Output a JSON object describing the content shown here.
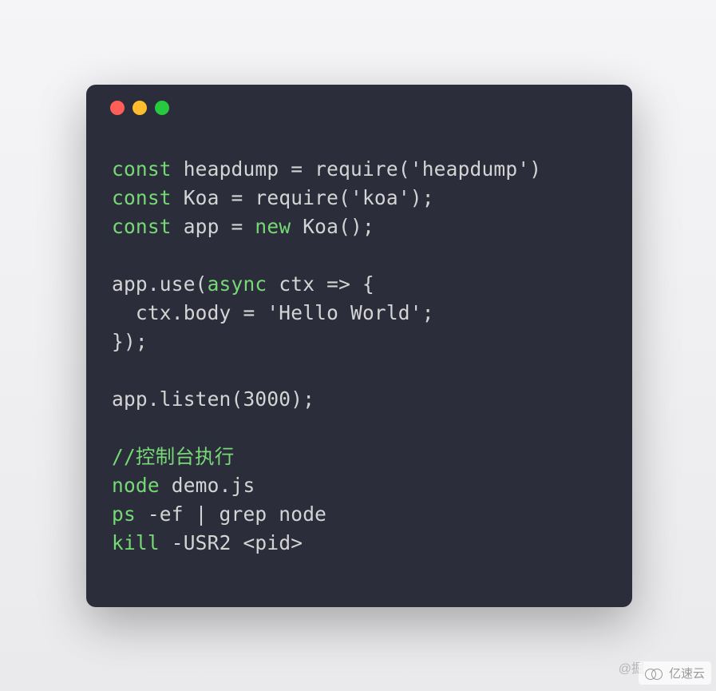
{
  "colors": {
    "terminal_bg": "#2b2d3a",
    "keyword": "#77d876",
    "text": "#d4d4d4",
    "red": "#ff5f56",
    "yellow": "#ffbd2e",
    "green": "#27c93f"
  },
  "code": {
    "lines": [
      {
        "tokens": [
          {
            "t": "const",
            "c": "kw"
          },
          {
            "t": " heapdump = require(",
            "c": "fn"
          },
          {
            "t": "'heapdump'",
            "c": "str"
          },
          {
            "t": ")",
            "c": "fn"
          }
        ]
      },
      {
        "tokens": [
          {
            "t": "const",
            "c": "kw"
          },
          {
            "t": " Koa = require(",
            "c": "fn"
          },
          {
            "t": "'koa'",
            "c": "str"
          },
          {
            "t": ");",
            "c": "fn"
          }
        ]
      },
      {
        "tokens": [
          {
            "t": "const",
            "c": "kw"
          },
          {
            "t": " app = ",
            "c": "fn"
          },
          {
            "t": "new",
            "c": "kw"
          },
          {
            "t": " Koa();",
            "c": "fn"
          }
        ]
      },
      {
        "tokens": []
      },
      {
        "tokens": [
          {
            "t": "app.use(",
            "c": "fn"
          },
          {
            "t": "async",
            "c": "kw"
          },
          {
            "t": " ctx => {",
            "c": "fn"
          }
        ]
      },
      {
        "tokens": [
          {
            "t": "  ctx.body = ",
            "c": "fn"
          },
          {
            "t": "'Hello World'",
            "c": "str"
          },
          {
            "t": ";",
            "c": "fn"
          }
        ]
      },
      {
        "tokens": [
          {
            "t": "});",
            "c": "fn"
          }
        ]
      },
      {
        "tokens": []
      },
      {
        "tokens": [
          {
            "t": "app.listen(",
            "c": "fn"
          },
          {
            "t": "3000",
            "c": "num"
          },
          {
            "t": ");",
            "c": "fn"
          }
        ]
      },
      {
        "tokens": []
      },
      {
        "tokens": [
          {
            "t": "//控制台执行",
            "c": "cmt"
          }
        ]
      },
      {
        "tokens": [
          {
            "t": "node",
            "c": "cmd"
          },
          {
            "t": " demo.js",
            "c": "fn"
          }
        ]
      },
      {
        "tokens": [
          {
            "t": "ps",
            "c": "cmd"
          },
          {
            "t": " -ef | grep node",
            "c": "fn"
          }
        ]
      },
      {
        "tokens": [
          {
            "t": "kill",
            "c": "cmd"
          },
          {
            "t": " -USR2 <pid>",
            "c": "fn"
          }
        ]
      }
    ]
  },
  "watermark": {
    "text": "@掘",
    "brand": "亿速云"
  }
}
